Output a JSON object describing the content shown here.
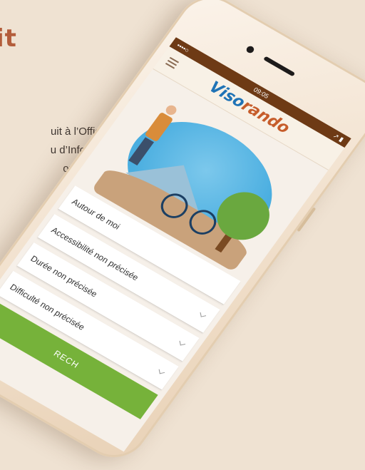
{
  "page": {
    "title": "it",
    "text_lines": [
      "uit à l’Office de",
      "u d’Information",
      "ou en ligne :"
    ]
  },
  "status_bar": {
    "carrier": "••••○",
    "time": "09:05",
    "right": "↗ ▮"
  },
  "app": {
    "logo_part1": "Viso",
    "logo_part2": "rando"
  },
  "form": {
    "fields": [
      {
        "label": "Autour de moi"
      },
      {
        "label": "Accessibilité non précisée"
      },
      {
        "label": "Durée non précisée"
      },
      {
        "label": "Difficulté non précisée"
      }
    ],
    "search_button": "RECH"
  },
  "colors": {
    "background": "#efe2d2",
    "title": "#b35d3b",
    "status_bar": "#6e3a15",
    "logo_blue": "#1f73b6",
    "logo_orange": "#c65d2b",
    "button_green": "#76b23a"
  }
}
